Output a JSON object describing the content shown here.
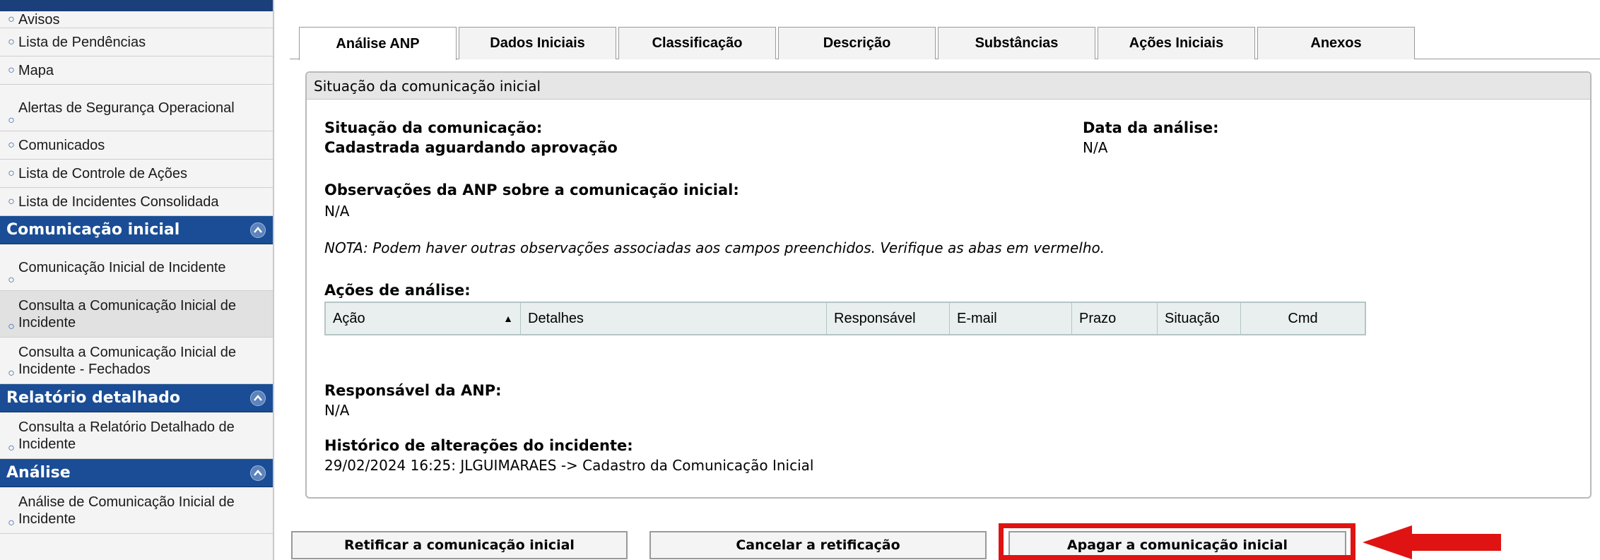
{
  "sidebar": {
    "top_items": [
      {
        "label": "Avisos"
      },
      {
        "label": "Lista de Pendências"
      },
      {
        "label": "Mapa"
      },
      {
        "label": "Alertas de Segurança Operacional"
      },
      {
        "label": "Comunicados"
      },
      {
        "label": "Lista de Controle de Ações"
      },
      {
        "label": "Lista de Incidentes Consolidada"
      }
    ],
    "sections": [
      {
        "title": "Comunicação inicial",
        "items": [
          {
            "label": "Comunicação Inicial de Incidente"
          },
          {
            "label": "Consulta a Comunicação Inicial de Incidente"
          },
          {
            "label": "Consulta a Comunicação Inicial de Incidente - Fechados"
          }
        ]
      },
      {
        "title": "Relatório detalhado",
        "items": [
          {
            "label": "Consulta a Relatório Detalhado de Incidente"
          }
        ]
      },
      {
        "title": "Análise",
        "items": [
          {
            "label": "Análise de Comunicação Inicial de Incidente"
          }
        ]
      }
    ]
  },
  "tabs": [
    {
      "label": "Análise ANP"
    },
    {
      "label": "Dados Iniciais"
    },
    {
      "label": "Classificação"
    },
    {
      "label": "Descrição"
    },
    {
      "label": "Substâncias"
    },
    {
      "label": "Ações Iniciais"
    },
    {
      "label": "Anexos"
    }
  ],
  "panel": {
    "title": "Situação da comunicação inicial",
    "situacao_label": "Situação da comunicação:",
    "situacao_value": "Cadastrada aguardando aprovação",
    "data_label": "Data da análise:",
    "data_value": "N/A",
    "obs_label": "Observações da ANP sobre a comunicação inicial:",
    "obs_value": "N/A",
    "note": "NOTA: Podem haver outras observações associadas aos campos preenchidos. Verifique as abas em vermelho.",
    "acoes_label": "Ações de análise:",
    "columns": [
      "Ação",
      "Detalhes",
      "Responsável",
      "E-mail",
      "Prazo",
      "Situação",
      "Cmd"
    ],
    "responsavel_label": "Responsável da ANP:",
    "responsavel_value": "N/A",
    "historico_label": "Histórico de alterações do incidente:",
    "historico_value": "29/02/2024 16:25: JLGUIMARAES -> Cadastro da Comunicação Inicial"
  },
  "buttons": {
    "retificar": "Retificar a comunicação inicial",
    "cancelar": "Cancelar a retificação",
    "apagar": "Apagar a comunicação inicial"
  },
  "colors": {
    "sidebar_header": "#1a4d95",
    "highlight": "#e01313"
  },
  "icons": {
    "collapse": "chevron-up-icon",
    "sort": "sort-ascending-icon",
    "bullet": "circle-bullet-icon",
    "annotation": "red-arrow-icon"
  }
}
